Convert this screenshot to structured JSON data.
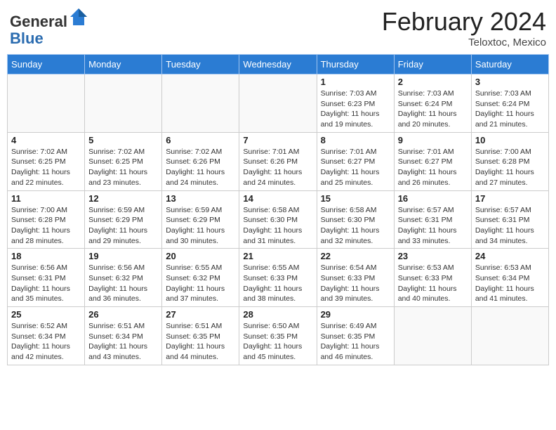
{
  "header": {
    "logo_line1": "General",
    "logo_line2": "Blue",
    "month_year": "February 2024",
    "location": "Teloxtoc, Mexico"
  },
  "days_of_week": [
    "Sunday",
    "Monday",
    "Tuesday",
    "Wednesday",
    "Thursday",
    "Friday",
    "Saturday"
  ],
  "weeks": [
    [
      {
        "day": "",
        "info": ""
      },
      {
        "day": "",
        "info": ""
      },
      {
        "day": "",
        "info": ""
      },
      {
        "day": "",
        "info": ""
      },
      {
        "day": "1",
        "info": "Sunrise: 7:03 AM\nSunset: 6:23 PM\nDaylight: 11 hours and 19 minutes."
      },
      {
        "day": "2",
        "info": "Sunrise: 7:03 AM\nSunset: 6:24 PM\nDaylight: 11 hours and 20 minutes."
      },
      {
        "day": "3",
        "info": "Sunrise: 7:03 AM\nSunset: 6:24 PM\nDaylight: 11 hours and 21 minutes."
      }
    ],
    [
      {
        "day": "4",
        "info": "Sunrise: 7:02 AM\nSunset: 6:25 PM\nDaylight: 11 hours and 22 minutes."
      },
      {
        "day": "5",
        "info": "Sunrise: 7:02 AM\nSunset: 6:25 PM\nDaylight: 11 hours and 23 minutes."
      },
      {
        "day": "6",
        "info": "Sunrise: 7:02 AM\nSunset: 6:26 PM\nDaylight: 11 hours and 24 minutes."
      },
      {
        "day": "7",
        "info": "Sunrise: 7:01 AM\nSunset: 6:26 PM\nDaylight: 11 hours and 24 minutes."
      },
      {
        "day": "8",
        "info": "Sunrise: 7:01 AM\nSunset: 6:27 PM\nDaylight: 11 hours and 25 minutes."
      },
      {
        "day": "9",
        "info": "Sunrise: 7:01 AM\nSunset: 6:27 PM\nDaylight: 11 hours and 26 minutes."
      },
      {
        "day": "10",
        "info": "Sunrise: 7:00 AM\nSunset: 6:28 PM\nDaylight: 11 hours and 27 minutes."
      }
    ],
    [
      {
        "day": "11",
        "info": "Sunrise: 7:00 AM\nSunset: 6:28 PM\nDaylight: 11 hours and 28 minutes."
      },
      {
        "day": "12",
        "info": "Sunrise: 6:59 AM\nSunset: 6:29 PM\nDaylight: 11 hours and 29 minutes."
      },
      {
        "day": "13",
        "info": "Sunrise: 6:59 AM\nSunset: 6:29 PM\nDaylight: 11 hours and 30 minutes."
      },
      {
        "day": "14",
        "info": "Sunrise: 6:58 AM\nSunset: 6:30 PM\nDaylight: 11 hours and 31 minutes."
      },
      {
        "day": "15",
        "info": "Sunrise: 6:58 AM\nSunset: 6:30 PM\nDaylight: 11 hours and 32 minutes."
      },
      {
        "day": "16",
        "info": "Sunrise: 6:57 AM\nSunset: 6:31 PM\nDaylight: 11 hours and 33 minutes."
      },
      {
        "day": "17",
        "info": "Sunrise: 6:57 AM\nSunset: 6:31 PM\nDaylight: 11 hours and 34 minutes."
      }
    ],
    [
      {
        "day": "18",
        "info": "Sunrise: 6:56 AM\nSunset: 6:31 PM\nDaylight: 11 hours and 35 minutes."
      },
      {
        "day": "19",
        "info": "Sunrise: 6:56 AM\nSunset: 6:32 PM\nDaylight: 11 hours and 36 minutes."
      },
      {
        "day": "20",
        "info": "Sunrise: 6:55 AM\nSunset: 6:32 PM\nDaylight: 11 hours and 37 minutes."
      },
      {
        "day": "21",
        "info": "Sunrise: 6:55 AM\nSunset: 6:33 PM\nDaylight: 11 hours and 38 minutes."
      },
      {
        "day": "22",
        "info": "Sunrise: 6:54 AM\nSunset: 6:33 PM\nDaylight: 11 hours and 39 minutes."
      },
      {
        "day": "23",
        "info": "Sunrise: 6:53 AM\nSunset: 6:33 PM\nDaylight: 11 hours and 40 minutes."
      },
      {
        "day": "24",
        "info": "Sunrise: 6:53 AM\nSunset: 6:34 PM\nDaylight: 11 hours and 41 minutes."
      }
    ],
    [
      {
        "day": "25",
        "info": "Sunrise: 6:52 AM\nSunset: 6:34 PM\nDaylight: 11 hours and 42 minutes."
      },
      {
        "day": "26",
        "info": "Sunrise: 6:51 AM\nSunset: 6:34 PM\nDaylight: 11 hours and 43 minutes."
      },
      {
        "day": "27",
        "info": "Sunrise: 6:51 AM\nSunset: 6:35 PM\nDaylight: 11 hours and 44 minutes."
      },
      {
        "day": "28",
        "info": "Sunrise: 6:50 AM\nSunset: 6:35 PM\nDaylight: 11 hours and 45 minutes."
      },
      {
        "day": "29",
        "info": "Sunrise: 6:49 AM\nSunset: 6:35 PM\nDaylight: 11 hours and 46 minutes."
      },
      {
        "day": "",
        "info": ""
      },
      {
        "day": "",
        "info": ""
      }
    ]
  ]
}
